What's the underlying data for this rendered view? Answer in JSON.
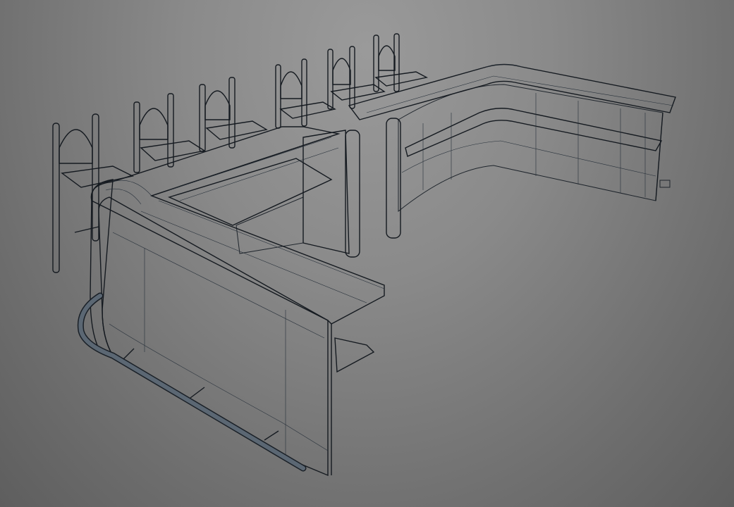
{
  "viewport": {
    "background_top": "#9a9a9a",
    "background_bottom": "#5e5e5e"
  },
  "scene": {
    "objects": [
      {
        "name": "bar-counter-main"
      },
      {
        "name": "bar-counter-return"
      },
      {
        "name": "bar-stool"
      },
      {
        "name": "bar-stool"
      },
      {
        "name": "bar-stool"
      },
      {
        "name": "bar-stool"
      },
      {
        "name": "bar-stool"
      },
      {
        "name": "bar-stool"
      },
      {
        "name": "foot-rail"
      }
    ],
    "colors": {
      "mesh_fill": "#4a5663",
      "mesh_fill_light": "#5a6673",
      "mesh_fill_dark": "#37414c",
      "wireframe": "#1f252c"
    }
  }
}
